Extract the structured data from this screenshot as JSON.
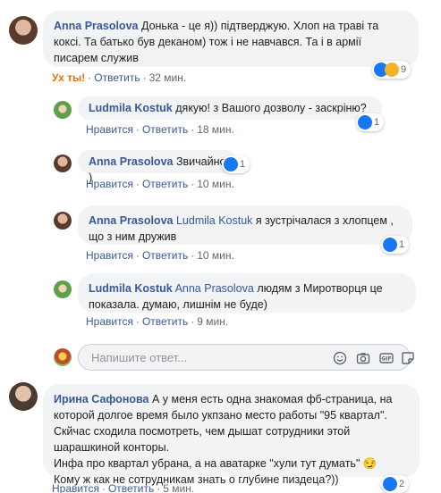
{
  "comments": [
    {
      "author": "Anna Prasolova",
      "text1": "Донька - це я)) підтверджую. Хлоп на траві та",
      "text2": "коксі. Та батько був деканом) тож і не навчався. Та і в армії",
      "text3": "писарем служив",
      "react_label": "Ух ты!",
      "reply": "Ответить",
      "time": "32 мин.",
      "reactions": "9"
    },
    {
      "author": "Ludmila Kostuk",
      "text": "дякую! з Вашого дозволу - заскріню?",
      "like": "Нравится",
      "reply": "Ответить",
      "time": "18 мин.",
      "reactions": "1"
    },
    {
      "author": "Anna Prasolova",
      "text": "Звичайно )",
      "like": "Нравится",
      "reply": "Ответить",
      "time": "10 мин.",
      "reactions": "1"
    },
    {
      "author": "Anna Prasolova",
      "mention": "Ludmila Kostuk",
      "text1": "я зустрічалася з хлопцем ,",
      "text2": "що з ним дружив",
      "like": "Нравится",
      "reply": "Ответить",
      "time": "10 мин.",
      "reactions": "1"
    },
    {
      "author": "Ludmila Kostuk",
      "mention": "Anna Prasolova",
      "text1": "людям з Миротворця це",
      "text2": "показала. думаю, лишнім не буде)",
      "like": "Нравится",
      "reply": "Ответить",
      "time": "9 мин."
    },
    {
      "author": "Ирина Сафонова",
      "text1": "А у меня есть одна знакомая фб-страница, на",
      "text2": "которой долгое время было укпзано место работы \"95 квартал\".",
      "text3": "Скйчас сходила посмотреть, чем дышат сотрудники этой",
      "text4": "шарашкиной конторы.",
      "text5": "Инфа про квартал убрана, а на аватарке \"хули тут думать\" 😏",
      "text6": "Кому ж как не сотрудникам знать о глубине пиздеца?))",
      "like": "Нравится",
      "reply": "Ответить",
      "time": "5 мин.",
      "reactions": "2"
    }
  ],
  "reply_box": {
    "placeholder": "Напишите ответ..."
  },
  "colors": {
    "link": "#385898",
    "bubble": "#f2f3f5",
    "wow": "#e9710f"
  }
}
